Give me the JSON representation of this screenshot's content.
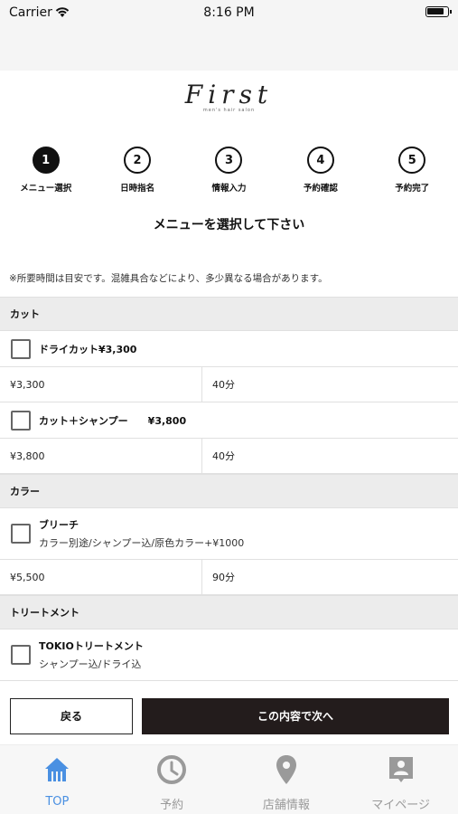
{
  "status_bar": {
    "carrier": "Carrier",
    "time": "8:16 PM"
  },
  "logo": {
    "main": "First",
    "sub": "men's hair salon"
  },
  "steps": [
    {
      "number": "1",
      "label": "メニュー選択"
    },
    {
      "number": "2",
      "label": "日時指名"
    },
    {
      "number": "3",
      "label": "情報入力"
    },
    {
      "number": "4",
      "label": "予約確認"
    },
    {
      "number": "5",
      "label": "予約完了"
    }
  ],
  "active_step": 1,
  "heading": "メニューを選択して下さい",
  "note": "※所要時間は目安です。混雑具合などにより、多少異なる場合があります。",
  "menu": {
    "cut": {
      "category": "カット",
      "items": [
        {
          "name": "ドライカット¥3,300",
          "price": "¥3,300",
          "time": "40分"
        },
        {
          "name": "カット＋シャンプー　　¥3,800",
          "price": "¥3,800",
          "time": "40分"
        }
      ]
    },
    "color": {
      "category": "カラー",
      "items": [
        {
          "name": "ブリーチ",
          "description": "カラー別途/シャンプー込/原色カラー+¥1000",
          "price": "¥5,500",
          "time": "90分"
        }
      ]
    },
    "treatment": {
      "category": "トリートメント",
      "items": [
        {
          "name": "TOKIOトリートメント",
          "description": "シャンプー込/ドライ込"
        }
      ]
    }
  },
  "buttons": {
    "back": "戻る",
    "next": "この内容で次へ"
  },
  "tabbar": [
    {
      "label": "TOP",
      "icon": "home-icon"
    },
    {
      "label": "予約",
      "icon": "clock-icon"
    },
    {
      "label": "店舗情報",
      "icon": "map-pin-icon"
    },
    {
      "label": "マイページ",
      "icon": "user-badge-icon"
    }
  ],
  "colors": {
    "accent": "#4a90e2",
    "inactive_tab": "#9a9a9a",
    "primary_button": "#231c1c"
  }
}
